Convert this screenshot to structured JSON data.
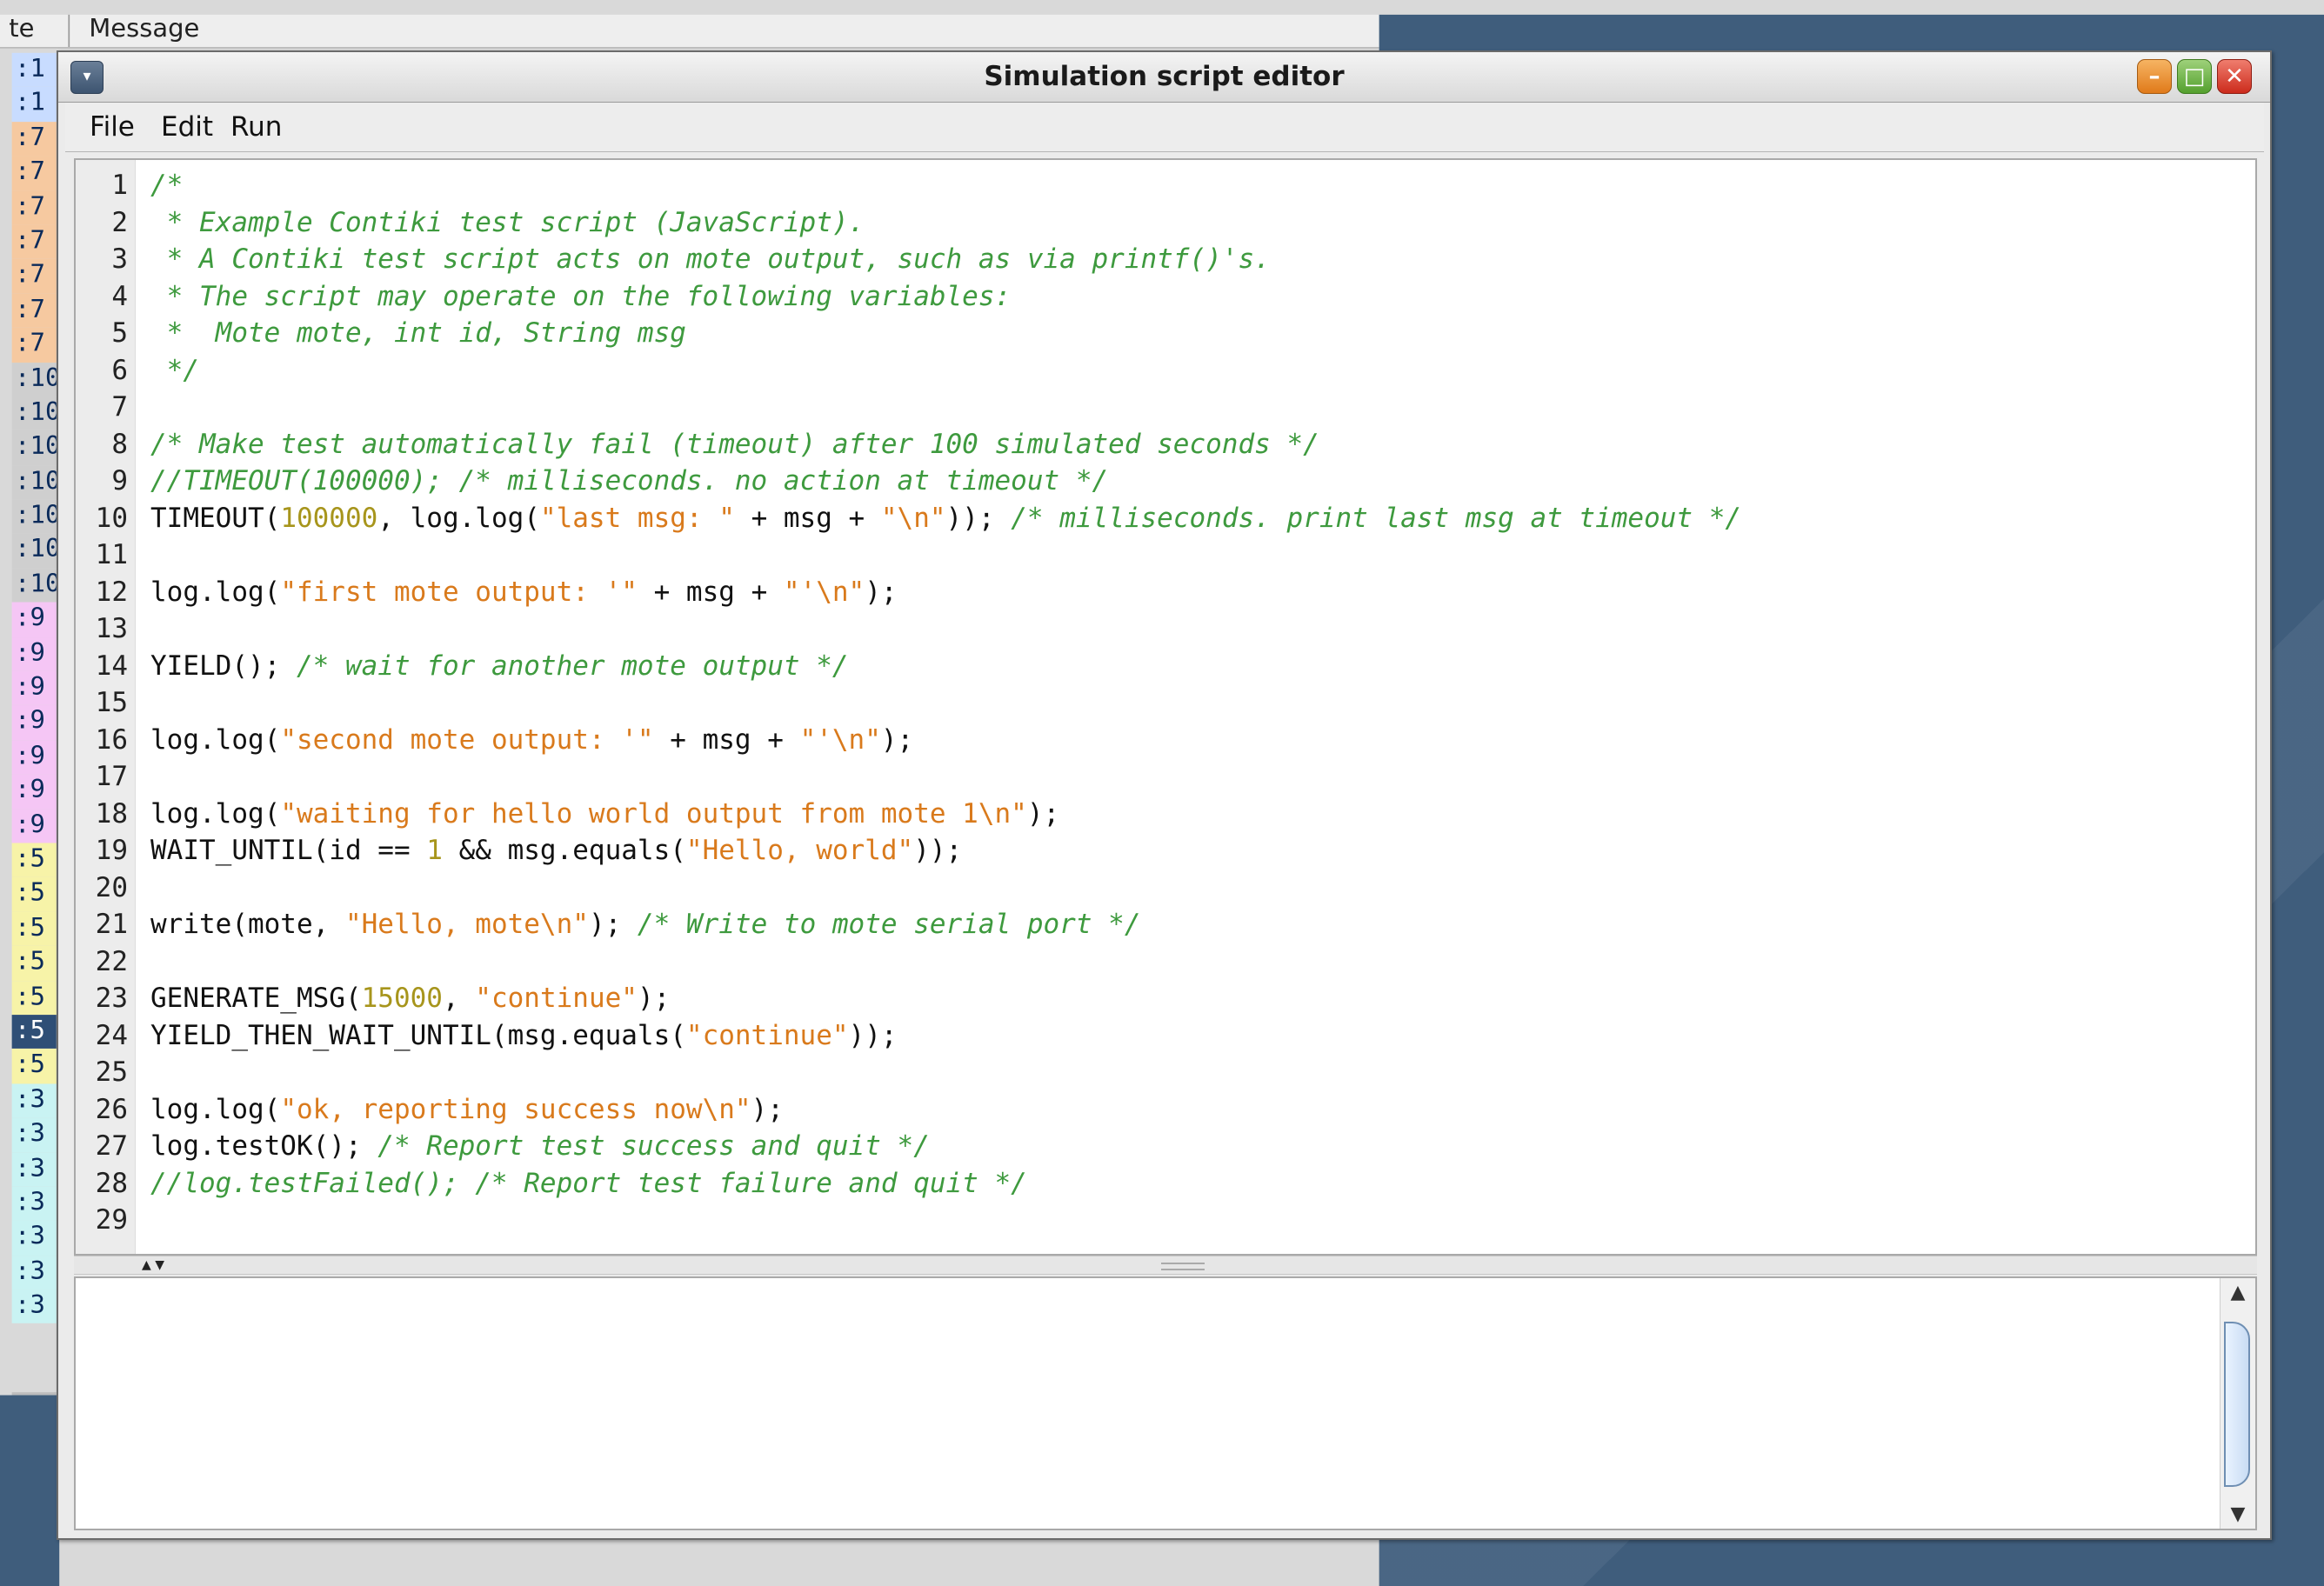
{
  "background": {
    "header": {
      "mote_col": "te",
      "message_col": "Message"
    },
    "rows": [
      {
        "t": ":1",
        "c": "#c8dcff"
      },
      {
        "t": ":1",
        "c": "#c8dcff"
      },
      {
        "t": ":7",
        "c": "#f6c9a0"
      },
      {
        "t": ":7",
        "c": "#f6c9a0"
      },
      {
        "t": ":7",
        "c": "#f6c9a0"
      },
      {
        "t": ":7",
        "c": "#f6c9a0"
      },
      {
        "t": ":7",
        "c": "#f6c9a0"
      },
      {
        "t": ":7",
        "c": "#f6c9a0"
      },
      {
        "t": ":7",
        "c": "#f6c9a0"
      },
      {
        "t": ":10",
        "c": "#cfcfcf"
      },
      {
        "t": ":10",
        "c": "#cfcfcf"
      },
      {
        "t": ":10",
        "c": "#cfcfcf"
      },
      {
        "t": ":10",
        "c": "#cfcfcf"
      },
      {
        "t": ":10",
        "c": "#cfcfcf"
      },
      {
        "t": ":10",
        "c": "#cfcfcf"
      },
      {
        "t": ":10",
        "c": "#cfcfcf"
      },
      {
        "t": ":9",
        "c": "#f5c6f5"
      },
      {
        "t": ":9",
        "c": "#f5c6f5"
      },
      {
        "t": ":9",
        "c": "#f5c6f5"
      },
      {
        "t": ":9",
        "c": "#f5c6f5"
      },
      {
        "t": ":9",
        "c": "#f5c6f5"
      },
      {
        "t": ":9",
        "c": "#f5c6f5"
      },
      {
        "t": ":9",
        "c": "#f5c6f5"
      },
      {
        "t": ":5",
        "c": "#f7f3a8"
      },
      {
        "t": ":5",
        "c": "#f7f3a8"
      },
      {
        "t": ":5",
        "c": "#f7f3a8"
      },
      {
        "t": ":5",
        "c": "#f7f3a8"
      },
      {
        "t": ":5",
        "c": "#f7f3a8"
      },
      {
        "t": ":5",
        "c": "#2f4f76",
        "sel": true
      },
      {
        "t": ":5",
        "c": "#f7f3a8"
      },
      {
        "t": ":3",
        "c": "#c9f3f3"
      },
      {
        "t": ":3",
        "c": "#c9f3f3"
      },
      {
        "t": ":3",
        "c": "#c9f3f3"
      },
      {
        "t": ":3",
        "c": "#c9f3f3"
      },
      {
        "t": ":3",
        "c": "#c9f3f3"
      },
      {
        "t": ":3",
        "c": "#c9f3f3"
      },
      {
        "t": ":3",
        "c": "#c9f3f3"
      }
    ]
  },
  "window": {
    "title": "Simulation script editor",
    "menu_icon": "window-menu-icon",
    "controls": {
      "minimize": "minimize-icon",
      "maximize": "maximize-icon",
      "close": "close-icon"
    }
  },
  "menubar": {
    "file": "File",
    "edit": "Edit",
    "run": "Run"
  },
  "editor": {
    "lines": [
      [
        [
          "c",
          "/*"
        ]
      ],
      [
        [
          "c",
          " * Example Contiki test script (JavaScript)."
        ]
      ],
      [
        [
          "c",
          " * A Contiki test script acts on mote output, such as via printf()'s."
        ]
      ],
      [
        [
          "c",
          " * The script may operate on the following variables:"
        ]
      ],
      [
        [
          "c",
          " *  Mote mote, int id, String msg"
        ]
      ],
      [
        [
          "c",
          " */"
        ]
      ],
      [],
      [
        [
          "c",
          "/* Make test automatically fail (timeout) after 100 simulated seconds */"
        ]
      ],
      [
        [
          "c",
          "//TIMEOUT(100000); /* milliseconds. no action at timeout */"
        ]
      ],
      [
        [
          "p",
          "TIMEOUT("
        ],
        [
          "n",
          "100000"
        ],
        [
          "p",
          ", log.log("
        ],
        [
          "s",
          "\"last msg: \""
        ],
        [
          "p",
          " + msg + "
        ],
        [
          "s",
          "\"\\n\""
        ],
        [
          "p",
          "));"
        ],
        [
          "c",
          " /* milliseconds. print last msg at timeout */"
        ]
      ],
      [],
      [
        [
          "p",
          "log.log("
        ],
        [
          "s",
          "\"first mote output: '\""
        ],
        [
          "p",
          " + msg + "
        ],
        [
          "s",
          "\"'\\n\""
        ],
        [
          "p",
          ");"
        ]
      ],
      [],
      [
        [
          "p",
          "YIELD();"
        ],
        [
          "c",
          " /* wait for another mote output */"
        ]
      ],
      [],
      [
        [
          "p",
          "log.log("
        ],
        [
          "s",
          "\"second mote output: '\""
        ],
        [
          "p",
          " + msg + "
        ],
        [
          "s",
          "\"'\\n\""
        ],
        [
          "p",
          ");"
        ]
      ],
      [],
      [
        [
          "p",
          "log.log("
        ],
        [
          "s",
          "\"waiting for hello world output from mote 1\\n\""
        ],
        [
          "p",
          ");"
        ]
      ],
      [
        [
          "p",
          "WAIT_UNTIL(id == "
        ],
        [
          "n",
          "1"
        ],
        [
          "p",
          " && msg.equals("
        ],
        [
          "s",
          "\"Hello, world\""
        ],
        [
          "p",
          "));"
        ]
      ],
      [],
      [
        [
          "p",
          "write(mote, "
        ],
        [
          "s",
          "\"Hello, mote\\n\""
        ],
        [
          "p",
          ");"
        ],
        [
          "c",
          " /* Write to mote serial port */"
        ]
      ],
      [],
      [
        [
          "p",
          "GENERATE_MSG("
        ],
        [
          "n",
          "15000"
        ],
        [
          "p",
          ", "
        ],
        [
          "s",
          "\"continue\""
        ],
        [
          "p",
          ");"
        ]
      ],
      [
        [
          "p",
          "YIELD_THEN_WAIT_UNTIL(msg.equals("
        ],
        [
          "s",
          "\"continue\""
        ],
        [
          "p",
          "));"
        ]
      ],
      [],
      [
        [
          "p",
          "log.log("
        ],
        [
          "s",
          "\"ok, reporting success now\\n\""
        ],
        [
          "p",
          ");"
        ]
      ],
      [
        [
          "p",
          "log.testOK();"
        ],
        [
          "c",
          " /* Report test success and quit */"
        ]
      ],
      [
        [
          "c",
          "//log.testFailed(); /* Report test failure and quit */"
        ]
      ],
      []
    ]
  },
  "output": {
    "text": ""
  },
  "colors": {
    "comment": "#3e9a3e",
    "string": "#d97a1c",
    "number": "#a7951c",
    "desktop": "#3f5d7c"
  }
}
